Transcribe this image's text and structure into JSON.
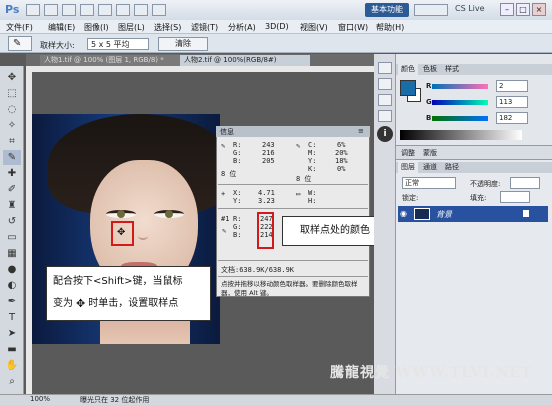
{
  "app": {
    "logo": "Ps",
    "workspace_label": "基本功能",
    "cslive_label": "CS Live"
  },
  "menus": [
    "文件(F)",
    "编辑(E)",
    "图像(I)",
    "图层(L)",
    "选择(S)",
    "滤镜(T)",
    "分析(A)",
    "3D(D)",
    "视图(V)",
    "窗口(W)",
    "帮助(H)"
  ],
  "options": {
    "size_label": "取样大小:",
    "size_value": "5 x 5 平均",
    "clear_label": "清除"
  },
  "tabs": [
    {
      "label": "人物1.tif @ 100% (图层 1, RGB/8) *"
    },
    {
      "label": "人物2.tif @ 100%(RGB/8#)"
    }
  ],
  "info_panel": {
    "title": "信息",
    "rgb": {
      "r": "243",
      "g": "216",
      "b": "205"
    },
    "cmyk": {
      "c": "6%",
      "m": "20%",
      "y": "18%",
      "k": "0%"
    },
    "bits_left": "8 位",
    "bits_right": "8 位",
    "xy": {
      "x": "4.71",
      "y": "3.23"
    },
    "wh": {
      "w": "",
      "h": ""
    },
    "sample": {
      "r": "247",
      "g": "222",
      "b": "214"
    },
    "sample_label": "#1",
    "doc": "文档:638.9K/638.9K",
    "hint": "点按并拖移以移动颜色取样器。要删除颜色取样器，使用 Alt 键。"
  },
  "callouts": {
    "c1_line1": "配合按下<Shift>键，当鼠标",
    "c1_line2": "变为",
    "c1_line3": "时单击，设置取样点",
    "c2": "取样点处的颜色"
  },
  "color_panel": {
    "tabs": [
      "颜色",
      "色板",
      "样式"
    ],
    "r": "2",
    "g": "113",
    "b": "182",
    "fg_color": "#1a6ca8"
  },
  "adjust_panel": {
    "tabs": [
      "调整",
      "蒙版"
    ]
  },
  "layers_panel": {
    "tabs": [
      "图层",
      "通道",
      "路径"
    ],
    "blend": "正常",
    "opacity_label": "不透明度:",
    "lock_label": "锁定:",
    "fill_label": "填充:",
    "layer_name": "背景"
  },
  "status": {
    "zoom": "100%",
    "text": "曝光只在 32 位起作用"
  },
  "watermark": "騰龍視覺 WWW.TLVI.NET"
}
